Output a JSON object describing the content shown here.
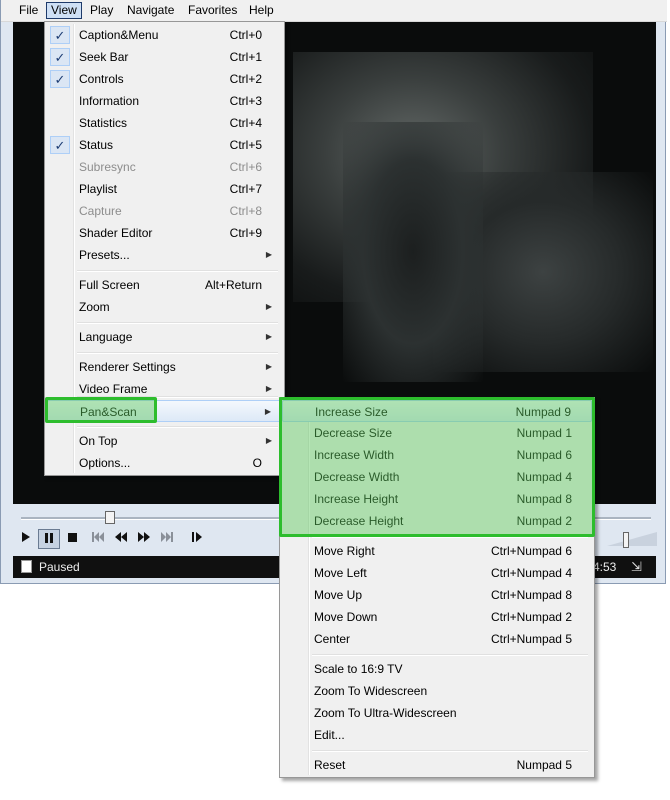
{
  "menubar": {
    "items": [
      {
        "label": "File"
      },
      {
        "label": "View"
      },
      {
        "label": "Play"
      },
      {
        "label": "Navigate"
      },
      {
        "label": "Favorites"
      },
      {
        "label": "Help"
      }
    ]
  },
  "view_menu": {
    "items": [
      {
        "label": "Caption&Menu",
        "shortcut": "Ctrl+0",
        "checked": true
      },
      {
        "label": "Seek Bar",
        "shortcut": "Ctrl+1",
        "checked": true
      },
      {
        "label": "Controls",
        "shortcut": "Ctrl+2",
        "checked": true
      },
      {
        "label": "Information",
        "shortcut": "Ctrl+3"
      },
      {
        "label": "Statistics",
        "shortcut": "Ctrl+4"
      },
      {
        "label": "Status",
        "shortcut": "Ctrl+5",
        "checked": true
      },
      {
        "label": "Subresync",
        "shortcut": "Ctrl+6",
        "disabled": true
      },
      {
        "label": "Playlist",
        "shortcut": "Ctrl+7"
      },
      {
        "label": "Capture",
        "shortcut": "Ctrl+8",
        "disabled": true
      },
      {
        "label": "Shader Editor",
        "shortcut": "Ctrl+9"
      },
      {
        "label": "Presets...",
        "submenu": true
      },
      {
        "label": "Full Screen",
        "shortcut": "Alt+Return"
      },
      {
        "label": "Zoom",
        "submenu": true
      },
      {
        "label": "Language",
        "submenu": true
      },
      {
        "label": "Renderer Settings",
        "submenu": true
      },
      {
        "label": "Video Frame",
        "submenu": true
      },
      {
        "label": "Pan&Scan",
        "submenu": true,
        "highlighted": true
      },
      {
        "label": "On Top",
        "submenu": true
      },
      {
        "label": "Options...",
        "shortcut": "O"
      }
    ]
  },
  "panscan_menu": {
    "items": [
      {
        "label": "Increase Size",
        "shortcut": "Numpad 9",
        "highlighted": true
      },
      {
        "label": "Decrease Size",
        "shortcut": "Numpad 1"
      },
      {
        "label": "Increase Width",
        "shortcut": "Numpad 6"
      },
      {
        "label": "Decrease Width",
        "shortcut": "Numpad 4"
      },
      {
        "label": "Increase Height",
        "shortcut": "Numpad 8"
      },
      {
        "label": "Decrease Height",
        "shortcut": "Numpad 2"
      },
      {
        "label": "Move Right",
        "shortcut": "Ctrl+Numpad 6"
      },
      {
        "label": "Move Left",
        "shortcut": "Ctrl+Numpad 4"
      },
      {
        "label": "Move Up",
        "shortcut": "Ctrl+Numpad 8"
      },
      {
        "label": "Move Down",
        "shortcut": "Ctrl+Numpad 2"
      },
      {
        "label": "Center",
        "shortcut": "Ctrl+Numpad 5"
      },
      {
        "label": "Scale to 16:9 TV"
      },
      {
        "label": "Zoom To Widescreen"
      },
      {
        "label": "Zoom To Ultra-Widescreen"
      },
      {
        "label": "Edit..."
      },
      {
        "label": "Reset",
        "shortcut": "Numpad 5"
      }
    ]
  },
  "controls": {
    "play_icon": "play-icon",
    "pause_icon": "pause-icon",
    "stop_icon": "stop-icon",
    "prev_icon": "skip-back-icon",
    "rewind_icon": "rewind-icon",
    "forward_icon": "fast-forward-icon",
    "next_icon": "skip-forward-icon",
    "frame_step_icon": "frame-step-icon",
    "pause_pressed": true
  },
  "status": {
    "text": "Paused",
    "time": "4:53"
  },
  "colors": {
    "highlight_green": "#2dbd2d",
    "video_bg": "#0a0c0c",
    "check_blue": "#1d3d74"
  }
}
